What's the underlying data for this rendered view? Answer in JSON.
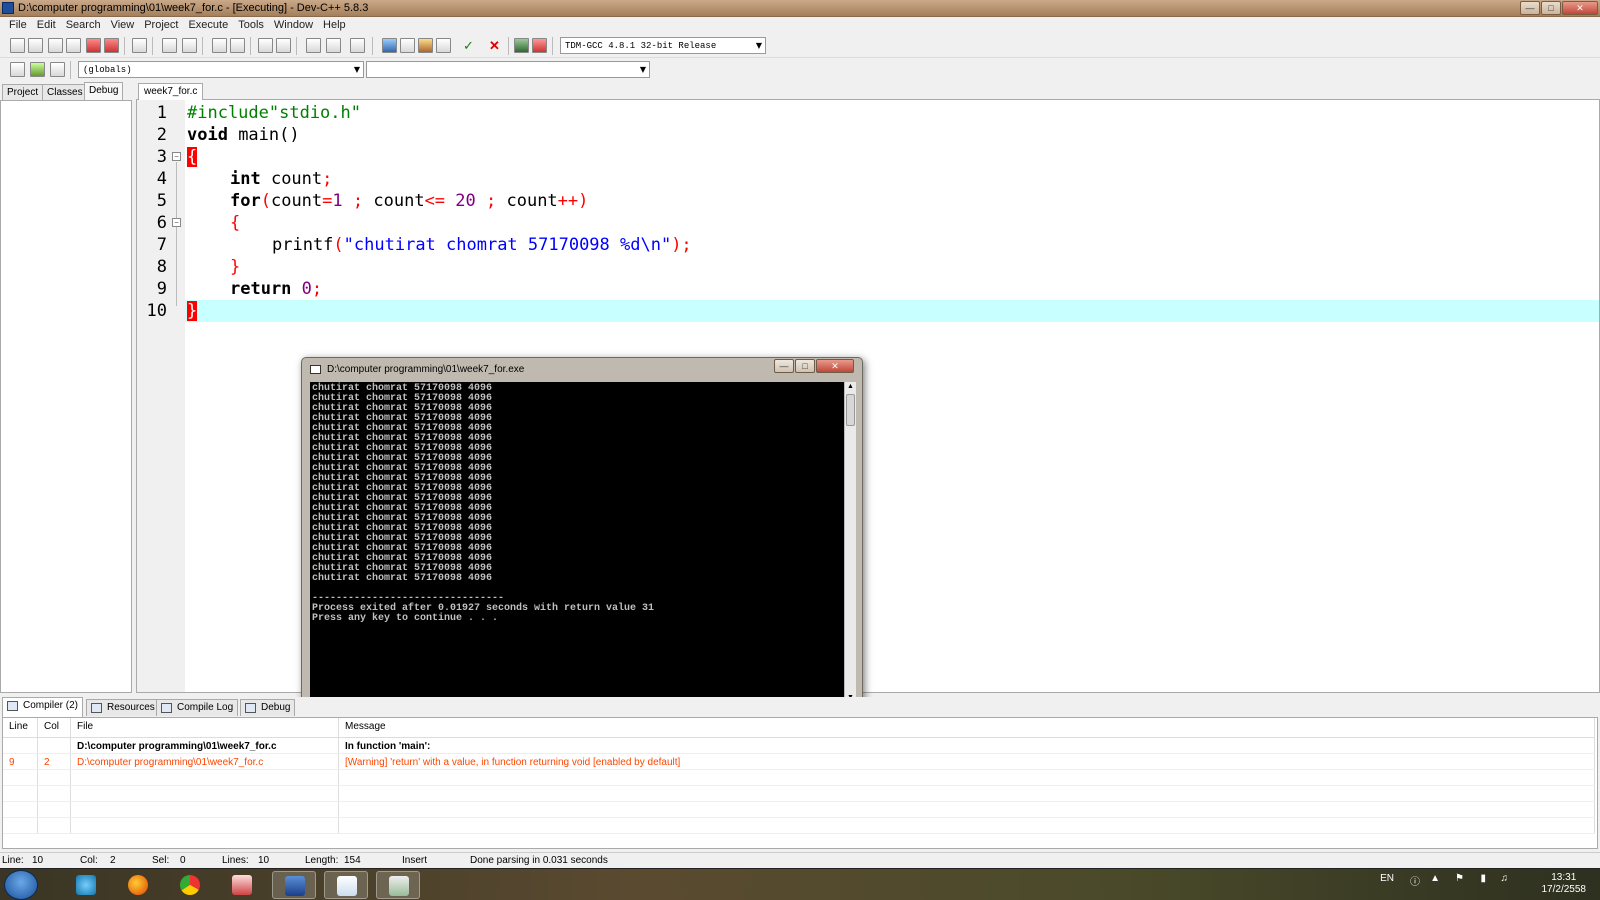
{
  "window": {
    "title": "D:\\computer programming\\01\\week7_for.c - [Executing] - Dev-C++ 5.8.3"
  },
  "menu": [
    "File",
    "Edit",
    "Search",
    "View",
    "Project",
    "Execute",
    "Tools",
    "Window",
    "Help"
  ],
  "toolbar": {
    "compiler_select": "TDM-GCC 4.8.1 32-bit Release",
    "scope_select": "(globals)",
    "function_select": ""
  },
  "left_tabs": [
    "Project",
    "Classes",
    "Debug"
  ],
  "editor": {
    "tab": "week7_for.c",
    "line_numbers": [
      "1",
      "2",
      "3",
      "4",
      "5",
      "6",
      "7",
      "8",
      "9",
      "10"
    ],
    "code": {
      "l1_pre": "#include\"stdio.h\"",
      "l2_kw": "void",
      "l2_rest": " main()",
      "brace_open": "{",
      "brace_close": "}",
      "l4_kw": "int",
      "l4_rest": " count",
      "semi": ";",
      "l5_kw": "for",
      "l5_a": "(count",
      "l5_eq": "=",
      "l5_n1": "1",
      "l5_b": " ; count",
      "l5_le": "<=",
      "l5_n2": " 20",
      "l5_c": " ; count",
      "l5_pp": "++",
      "l5_paren": ")",
      "l7_fn": "printf",
      "l7_open": "(",
      "l7_str": "\"chutirat chomrat 57170098 %d\\n\"",
      "l7_close": ");",
      "l9_kw": "return",
      "l9_n": " 0"
    }
  },
  "console": {
    "title": "D:\\computer programming\\01\\week7_for.exe",
    "output_line": "chutirat chomrat 57170098 4096",
    "separator": "--------------------------------",
    "exit_msg": "Process exited after 0.01927 seconds with return value 31",
    "press_msg": "Press any key to continue . . ."
  },
  "bottom_tabs": [
    "Compiler (2)",
    "Resources",
    "Compile Log",
    "Debug"
  ],
  "messages": {
    "headers": [
      "Line",
      "Col",
      "File",
      "Message"
    ],
    "rows": [
      {
        "line": "",
        "col": "",
        "file": "D:\\computer programming\\01\\week7_for.c",
        "message": "In function 'main':"
      },
      {
        "line": "9",
        "col": "2",
        "file": "D:\\computer programming\\01\\week7_for.c",
        "message": "[Warning] 'return' with a value, in function returning void [enabled by default]"
      }
    ]
  },
  "status": {
    "line": "Line:",
    "line_v": "10",
    "col": "Col:",
    "col_v": "2",
    "sel": "Sel:",
    "sel_v": "0",
    "lines": "Lines:",
    "lines_v": "10",
    "length": "Length:",
    "length_v": "154",
    "mode": "Insert",
    "parse": "Done parsing in 0.031 seconds"
  },
  "taskbar": {
    "lang": "EN",
    "time": "13:31",
    "date": "17/2/2558"
  }
}
